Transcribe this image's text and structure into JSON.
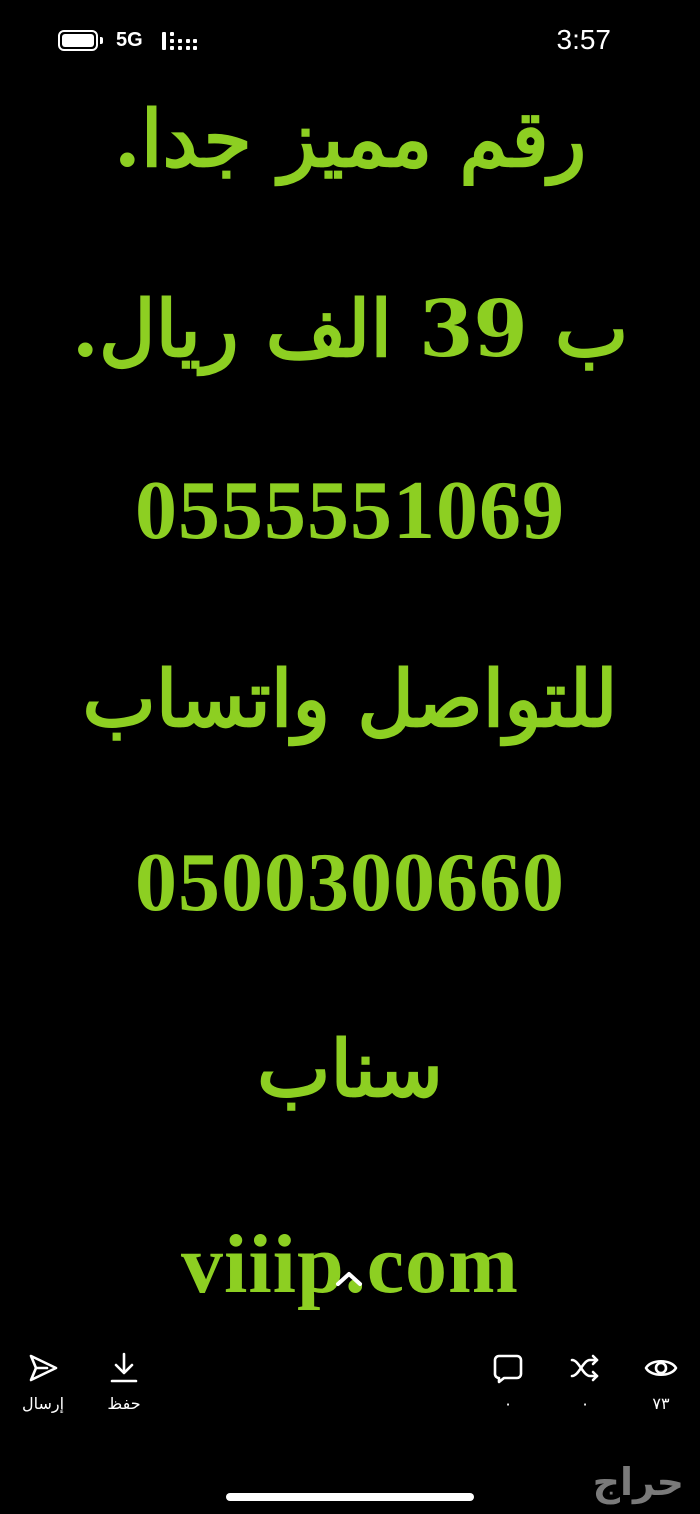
{
  "status_bar": {
    "network": "5G",
    "time": "3:57"
  },
  "post": {
    "lines": [
      "رقم مميز جدا.",
      "ب 39 الف ريال.",
      "0555551069",
      "للتواصل واتساب",
      "0500300660",
      "سناب",
      "viiip.com"
    ]
  },
  "actions": {
    "send_label": "إرسال",
    "save_label": "حفظ",
    "comments_count": "٠",
    "shares_count": "٠",
    "views_count": "٧٣"
  },
  "footer": {
    "logo_text": "حراج"
  },
  "colors": {
    "background": "#000000",
    "text_accent": "#8dcf22",
    "foreground": "#ffffff"
  },
  "icons": [
    "send-icon",
    "download-icon",
    "comment-icon",
    "share-icon",
    "eye-icon",
    "chevron-up-icon"
  ]
}
